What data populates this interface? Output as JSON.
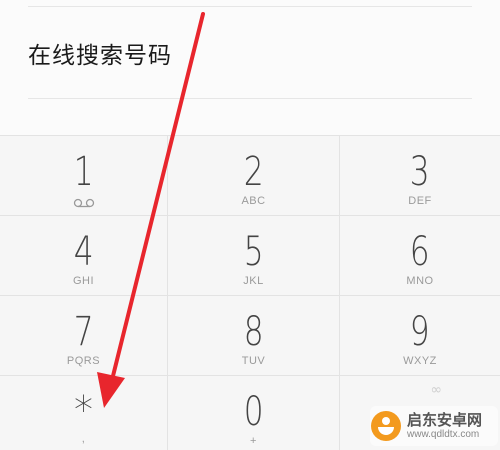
{
  "search": {
    "label": "在线搜索号码"
  },
  "keypad": {
    "keys": [
      {
        "digit": "1",
        "letters": "",
        "icon": "voicemail-icon"
      },
      {
        "digit": "2",
        "letters": "ABC"
      },
      {
        "digit": "3",
        "letters": "DEF"
      },
      {
        "digit": "4",
        "letters": "GHI"
      },
      {
        "digit": "5",
        "letters": "JKL"
      },
      {
        "digit": "6",
        "letters": "MNO"
      },
      {
        "digit": "7",
        "letters": "PQRS"
      },
      {
        "digit": "8",
        "letters": "TUV"
      },
      {
        "digit": "9",
        "letters": "WXYZ"
      },
      {
        "digit": "*",
        "letters": ","
      },
      {
        "digit": "0",
        "letters": "+"
      },
      {
        "digit": "",
        "letters": "",
        "glyph": "∞"
      }
    ]
  },
  "annotation": {
    "color": "#e8262d"
  },
  "watermark": {
    "title": "启东安卓网",
    "url": "www.qdldtx.com"
  }
}
